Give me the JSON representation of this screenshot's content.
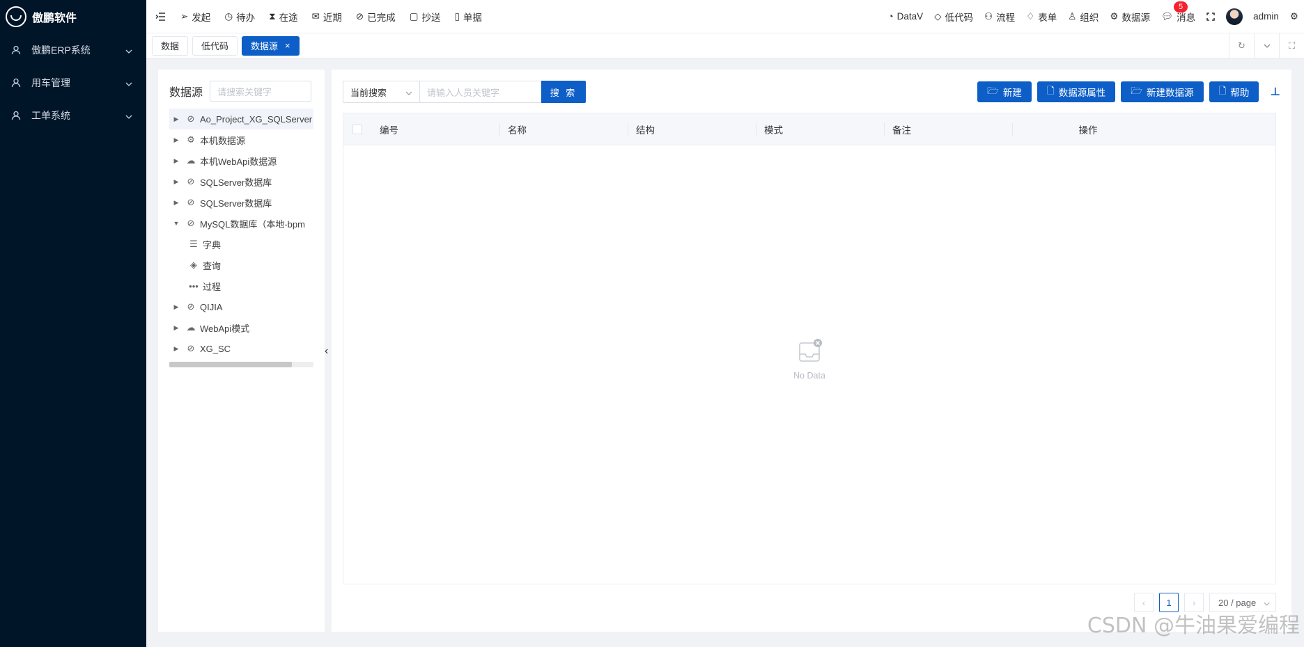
{
  "app": {
    "name": "傲鹏软件"
  },
  "sidebar": {
    "items": [
      {
        "label": "傲鹏ERP系统"
      },
      {
        "label": "用车管理"
      },
      {
        "label": "工单系统"
      }
    ]
  },
  "topnav": {
    "left": [
      {
        "label": "发起",
        "icon": "send-icon"
      },
      {
        "label": "待办",
        "icon": "clock-icon"
      },
      {
        "label": "在途",
        "icon": "hourglass-icon"
      },
      {
        "label": "近期",
        "icon": "mail-icon"
      },
      {
        "label": "已完成",
        "icon": "check-circle-icon"
      },
      {
        "label": "抄送",
        "icon": "clipboard-icon"
      },
      {
        "label": "单据",
        "icon": "document-icon"
      }
    ],
    "right": [
      {
        "label": "DataV",
        "icon": "datav-icon"
      },
      {
        "label": "低代码",
        "icon": "tag-icon"
      },
      {
        "label": "流程",
        "icon": "flow-icon"
      },
      {
        "label": "表单",
        "icon": "diamond-icon"
      },
      {
        "label": "组织",
        "icon": "org-icon"
      },
      {
        "label": "数据源",
        "icon": "gear-icon"
      }
    ],
    "messages_label": "消息",
    "messages_count": "5",
    "user": "admin"
  },
  "tabs": [
    {
      "label": "数据",
      "active": false
    },
    {
      "label": "低代码",
      "active": false
    },
    {
      "label": "数据源",
      "active": true
    }
  ],
  "tree": {
    "title": "数据源",
    "search_placeholder": "请搜索关键字",
    "nodes": [
      {
        "label": "Ao_Project_XG_SQLServer",
        "icon": "db-icon",
        "expanded": false,
        "selected": true
      },
      {
        "label": "本机数据源",
        "icon": "gear-icon",
        "expanded": false
      },
      {
        "label": "本机WebApi数据源",
        "icon": "cloud-icon",
        "expanded": false
      },
      {
        "label": "SQLServer数据库",
        "icon": "db-icon",
        "expanded": false
      },
      {
        "label": "SQLServer数据库",
        "icon": "db-icon",
        "expanded": false
      },
      {
        "label": "MySQL数据库（本地-bpm",
        "icon": "db-icon",
        "expanded": true
      },
      {
        "label": "字典",
        "icon": "list-icon",
        "child": true
      },
      {
        "label": "查询",
        "icon": "layers-icon",
        "child": true
      },
      {
        "label": "过程",
        "icon": "more-icon",
        "child": true
      },
      {
        "label": "QIJIA",
        "icon": "db-icon",
        "expanded": false
      },
      {
        "label": "WebApi模式",
        "icon": "cloud-icon",
        "expanded": false
      },
      {
        "label": "XG_SC",
        "icon": "db-icon",
        "expanded": false
      }
    ]
  },
  "toolbar": {
    "scope_select": "当前搜索",
    "keyword_placeholder": "请输入人员关键字",
    "search_label": "搜 索",
    "buttons": [
      {
        "label": "新建",
        "icon": "folder-open-icon"
      },
      {
        "label": "数据源属性",
        "icon": "file-icon"
      },
      {
        "label": "新建数据源",
        "icon": "folder-open-icon"
      },
      {
        "label": "帮助",
        "icon": "file-icon"
      }
    ]
  },
  "table": {
    "columns": [
      "编号",
      "名称",
      "结构",
      "模式",
      "备注",
      "操作"
    ],
    "rows": [],
    "empty_text": "No Data"
  },
  "pagination": {
    "current_page": "1",
    "page_size": "20 / page"
  },
  "watermark": "CSDN @牛油果爱编程",
  "colors": {
    "sidebar_bg": "#011529",
    "primary": "#0d5ec7",
    "badge": "#f5222d"
  }
}
